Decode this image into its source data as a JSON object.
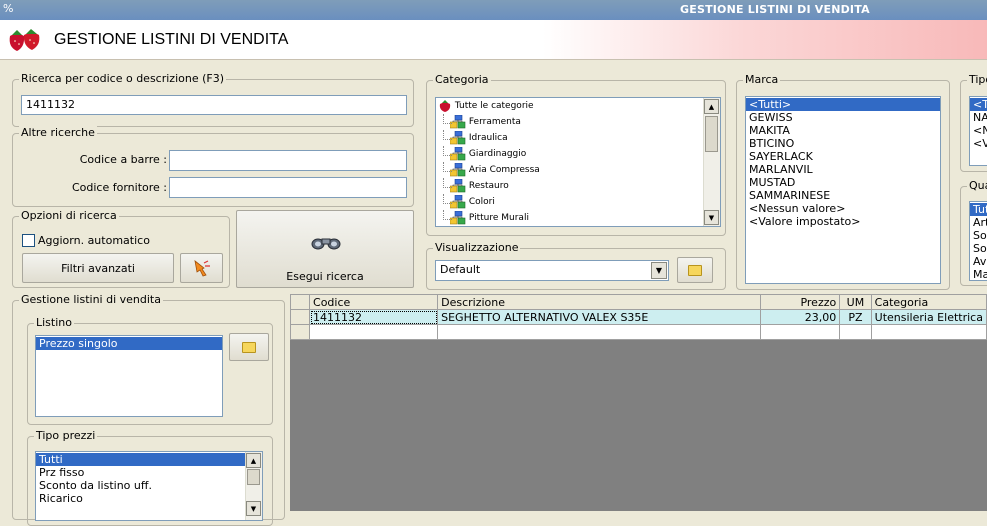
{
  "window": {
    "title": "GESTIONE LISTINI DI VENDITA",
    "header_title": "GESTIONE LISTINI DI VENDITA"
  },
  "search": {
    "group_label": "Ricerca per codice o descrizione (F3)",
    "value": "1411132"
  },
  "other_search": {
    "group_label": "Altre ricerche",
    "barcode_label": "Codice a barre :",
    "barcode_value": "",
    "supplier_code_label": "Codice fornitore :",
    "supplier_code_value": ""
  },
  "search_options": {
    "group_label": "Opzioni di ricerca",
    "auto_update_label": "Aggiorn. automatico",
    "auto_update_checked": false,
    "advanced_filters_label": "Filtri avanzati"
  },
  "execute_search": {
    "label": "Esegui ricerca"
  },
  "category": {
    "group_label": "Categoria",
    "root": "Tutte le categorie",
    "items": [
      "Ferramenta",
      "Idraulica",
      "Giardinaggio",
      "Aria Compressa",
      "Restauro",
      "Colori",
      "Pitture Murali"
    ]
  },
  "view": {
    "group_label": "Visualizzazione",
    "selected": "Default"
  },
  "brand": {
    "group_label": "Marca",
    "items": [
      "<Tutti>",
      "GEWISS",
      "MAKITA",
      "BTICINO",
      "SAYERLACK",
      "MARLANVIL",
      "MUSTAD",
      "SAMMARINESE",
      "<Nessun valore>",
      "<Valore impostato>"
    ],
    "selected_index": 0
  },
  "type_panel": {
    "group_label": "Tipo",
    "items": [
      "<T",
      "NAT",
      "<N",
      "<V"
    ]
  },
  "quantity_panel": {
    "group_label": "Qua",
    "items": [
      "Tut",
      "Art",
      "Solo",
      "Solo",
      "Ave",
      "Man"
    ]
  },
  "price_lists": {
    "group_label": "Gestione listini di vendita",
    "listino": {
      "group_label": "Listino",
      "items": [
        "Prezzo singolo"
      ]
    },
    "price_types": {
      "group_label": "Tipo prezzi",
      "items": [
        "Tutti",
        "Prz fisso",
        "Sconto da listino uff.",
        "Ricarico"
      ]
    }
  },
  "grid": {
    "columns": [
      "Codice",
      "Descrizione",
      "Prezzo",
      "UM",
      "Categoria"
    ],
    "rows": [
      {
        "codice": "1411132",
        "descrizione": "SEGHETTO ALTERNATIVO VALEX S35E",
        "prezzo": "23,00",
        "um": "PZ",
        "categoria": "Utensileria Elettrica"
      }
    ]
  },
  "colors": {
    "selection": "#316ac5",
    "row_highlight": "#cdeef0",
    "grid_bg": "#808080",
    "window_bg": "#ece9d8"
  },
  "icons": [
    "strawberry-icon",
    "binoculars-icon",
    "folder-icon",
    "hand-pointer-icon",
    "network-folder-icon"
  ]
}
